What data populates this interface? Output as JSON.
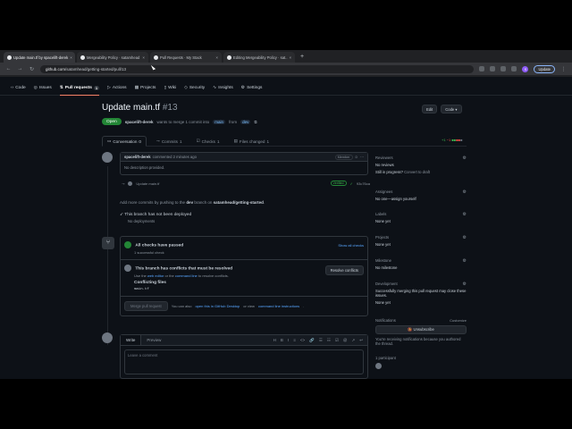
{
  "browser": {
    "tabs": [
      {
        "label": "Update main.tf by spacelift-derek",
        "active": true
      },
      {
        "label": "Mergeability Policy · satamhead",
        "active": false
      },
      {
        "label": "Pull Requests · My Stack",
        "active": false
      },
      {
        "label": "Editing Mergeability Policy · sat..",
        "active": false
      }
    ],
    "new_tab": "+",
    "url_host": "github.com",
    "url_path": "/satamhead/getting-started/pull/13",
    "update_label": "Update",
    "profile_initial": "S"
  },
  "repo_nav": {
    "items": [
      {
        "label": "Code",
        "count": ""
      },
      {
        "label": "Issues",
        "count": ""
      },
      {
        "label": "Pull requests",
        "count": "1"
      },
      {
        "label": "Actions",
        "count": ""
      },
      {
        "label": "Projects",
        "count": ""
      },
      {
        "label": "Wiki",
        "count": ""
      },
      {
        "label": "Security",
        "count": ""
      },
      {
        "label": "Insights",
        "count": ""
      },
      {
        "label": "Settings",
        "count": ""
      }
    ]
  },
  "pr": {
    "title": "Update main.tf",
    "number": "#13",
    "edit_label": "Edit",
    "code_label": "Code ▾",
    "status": "Open",
    "author": "spacelift-derek",
    "merge_text_1": "wants to merge 1 commit into",
    "base_branch": "main",
    "merge_text_2": "from",
    "head_branch": "dev",
    "tabs": [
      {
        "label": "Conversation",
        "count": "0"
      },
      {
        "label": "Commits",
        "count": "1"
      },
      {
        "label": "Checks",
        "count": "1"
      },
      {
        "label": "Files changed",
        "count": "1"
      }
    ],
    "diffstat_add": "+1",
    "diffstat_del": "−1"
  },
  "comment": {
    "author": "spacelift-derek",
    "action": "commented 2 minutes ago",
    "role": "Member",
    "body": "No description provided.",
    "commit_msg": "Update main.tf",
    "verified": "Verified",
    "commit_sha": "93c76ca"
  },
  "push_note": {
    "text_1": "Add more commits by pushing to the",
    "branch": "dev",
    "text_2": "branch on",
    "repo": "satamhead/getting-started",
    "text_3": "."
  },
  "deploy": {
    "title": "This branch has not been deployed",
    "sub": "No deployments"
  },
  "merge": {
    "checks_title": "All checks have passed",
    "checks_sub": "1 successful check",
    "show_all": "Show all checks",
    "conflict_title": "This branch has conflicts that must be resolved",
    "conflict_sub_1": "Use the",
    "web_editor": "web editor",
    "conflict_sub_2": "or the",
    "cmd_line": "command line",
    "conflict_sub_3": "to resolve conflicts.",
    "resolve_label": "Resolve conflicts",
    "conflicting_title": "Conflicting files",
    "conflicting_file": "main.tf",
    "merge_btn": "Merge pull request",
    "also_1": "You can also",
    "open_desktop": "open this in GitHub Desktop",
    "also_2": "or view",
    "cmd_instr": "command line instructions",
    "also_3": "."
  },
  "editor": {
    "write": "Write",
    "preview": "Preview",
    "placeholder": "Leave a comment",
    "tools": [
      "H",
      "B",
      "I",
      "≡",
      "<>",
      "🔗",
      "☰",
      "☷",
      "☑",
      "@",
      "↗",
      "↩"
    ]
  },
  "sidebar": {
    "reviewers_h": "Reviewers",
    "reviewers_v": "No reviews",
    "still_progress": "Still in progress?",
    "convert_draft": "Convert to draft",
    "assignees_h": "Assignees",
    "assignees_v": "No one—assign yourself",
    "labels_h": "Labels",
    "labels_v": "None yet",
    "projects_h": "Projects",
    "projects_v": "None yet",
    "milestone_h": "Milestone",
    "milestone_v": "No milestone",
    "development_h": "Development",
    "development_v": "Successfully merging this pull request may close these issues.",
    "development_v2": "None yet",
    "notifications_h": "Notifications",
    "customize": "Customize",
    "unsubscribe": "Unsubscribe",
    "notif_v": "You're receiving notifications because you authored the thread.",
    "participants": "1 participant"
  }
}
